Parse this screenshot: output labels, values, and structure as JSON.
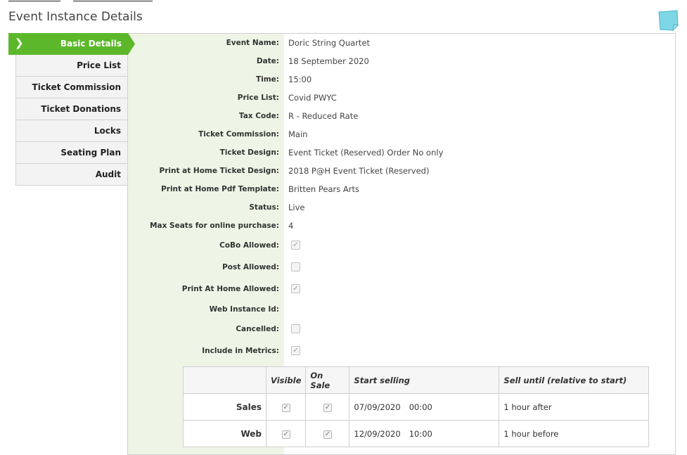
{
  "page": {
    "title": "Event Instance Details"
  },
  "tabs": {
    "active": "Basic Details",
    "items": [
      "Price List",
      "Ticket Commission",
      "Ticket Donations",
      "Locks",
      "Seating Plan",
      "Audit"
    ]
  },
  "details": [
    {
      "key": "event_name",
      "label": "Event Name:",
      "value": "Doric String Quartet"
    },
    {
      "key": "date",
      "label": "Date:",
      "value": "18 September 2020"
    },
    {
      "key": "time",
      "label": "Time:",
      "value": "15:00"
    },
    {
      "key": "price_list",
      "label": "Price List:",
      "value": "Covid PWYC"
    },
    {
      "key": "tax_code",
      "label": "Tax Code:",
      "value": "R - Reduced Rate"
    },
    {
      "key": "ticket_commission",
      "label": "Ticket Commission:",
      "value": "Main"
    },
    {
      "key": "ticket_design",
      "label": "Ticket Design:",
      "value": "Event Ticket (Reserved) Order No only"
    },
    {
      "key": "pah_ticket_design",
      "label": "Print at Home Ticket Design:",
      "value": "2018 P@H Event Ticket (Reserved)"
    },
    {
      "key": "pah_pdf_template",
      "label": "Print at Home Pdf Template:",
      "value": "Britten Pears Arts"
    },
    {
      "key": "status",
      "label": "Status:",
      "value": "Live"
    },
    {
      "key": "max_seats",
      "label": "Max Seats for online purchase:",
      "value": "4"
    }
  ],
  "flags": [
    {
      "key": "cobo_allowed",
      "label": "CoBo Allowed:",
      "checked": true
    },
    {
      "key": "post_allowed",
      "label": "Post Allowed:",
      "checked": false
    },
    {
      "key": "pah_allowed",
      "label": "Print At Home Allowed:",
      "checked": true
    },
    {
      "key": "web_instance_id",
      "label": "Web Instance Id:",
      "value": ""
    },
    {
      "key": "cancelled",
      "label": "Cancelled:",
      "checked": false
    },
    {
      "key": "include_metrics",
      "label": "Include in Metrics:",
      "checked": true
    }
  ],
  "schedule": {
    "headers": {
      "visible": "Visible",
      "on_sale": "On Sale",
      "start": "Start selling",
      "until": "Sell until (relative to start)"
    },
    "rows": [
      {
        "name": "Sales",
        "visible": true,
        "on_sale": true,
        "start_date": "07/09/2020",
        "start_time": "00:00",
        "until": "1 hour after"
      },
      {
        "name": "Web",
        "visible": true,
        "on_sale": true,
        "start_date": "12/09/2020",
        "start_time": "10:00",
        "until": "1 hour before"
      }
    ]
  },
  "colors": {
    "tab_active": "#5cb82a",
    "label_column_bg": "#eef5e6",
    "note_icon": "#7fd6e6"
  }
}
